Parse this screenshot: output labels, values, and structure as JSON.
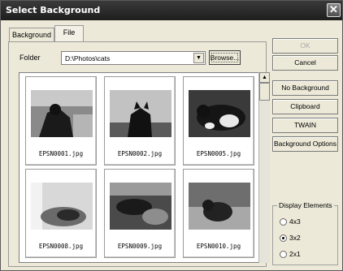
{
  "window": {
    "title": "Select Background",
    "close_glyph": "✕"
  },
  "tabs": [
    {
      "label": "Background"
    },
    {
      "label": "File"
    }
  ],
  "folder": {
    "label": "Folder",
    "value": "D:\\Photos\\cats",
    "browse_label": "Browse..."
  },
  "thumbnails": [
    {
      "caption": "EPSN0001.jpg"
    },
    {
      "caption": "EPSN0002.jpg"
    },
    {
      "caption": "EPSN0005.jpg"
    },
    {
      "caption": "EPSN0008.jpg"
    },
    {
      "caption": "EPSN0009.jpg"
    },
    {
      "caption": "EPSN0010.jpg"
    }
  ],
  "buttons": {
    "ok": "OK",
    "cancel": "Cancel",
    "no_background": "No Background",
    "clipboard": "Clipboard",
    "twain": "TWAIN",
    "background_options": "Background Options"
  },
  "display_elements": {
    "title": "Display Elements",
    "options": [
      {
        "label": "4x3",
        "checked": false
      },
      {
        "label": "3x2",
        "checked": true
      },
      {
        "label": "2x1",
        "checked": false
      }
    ]
  }
}
